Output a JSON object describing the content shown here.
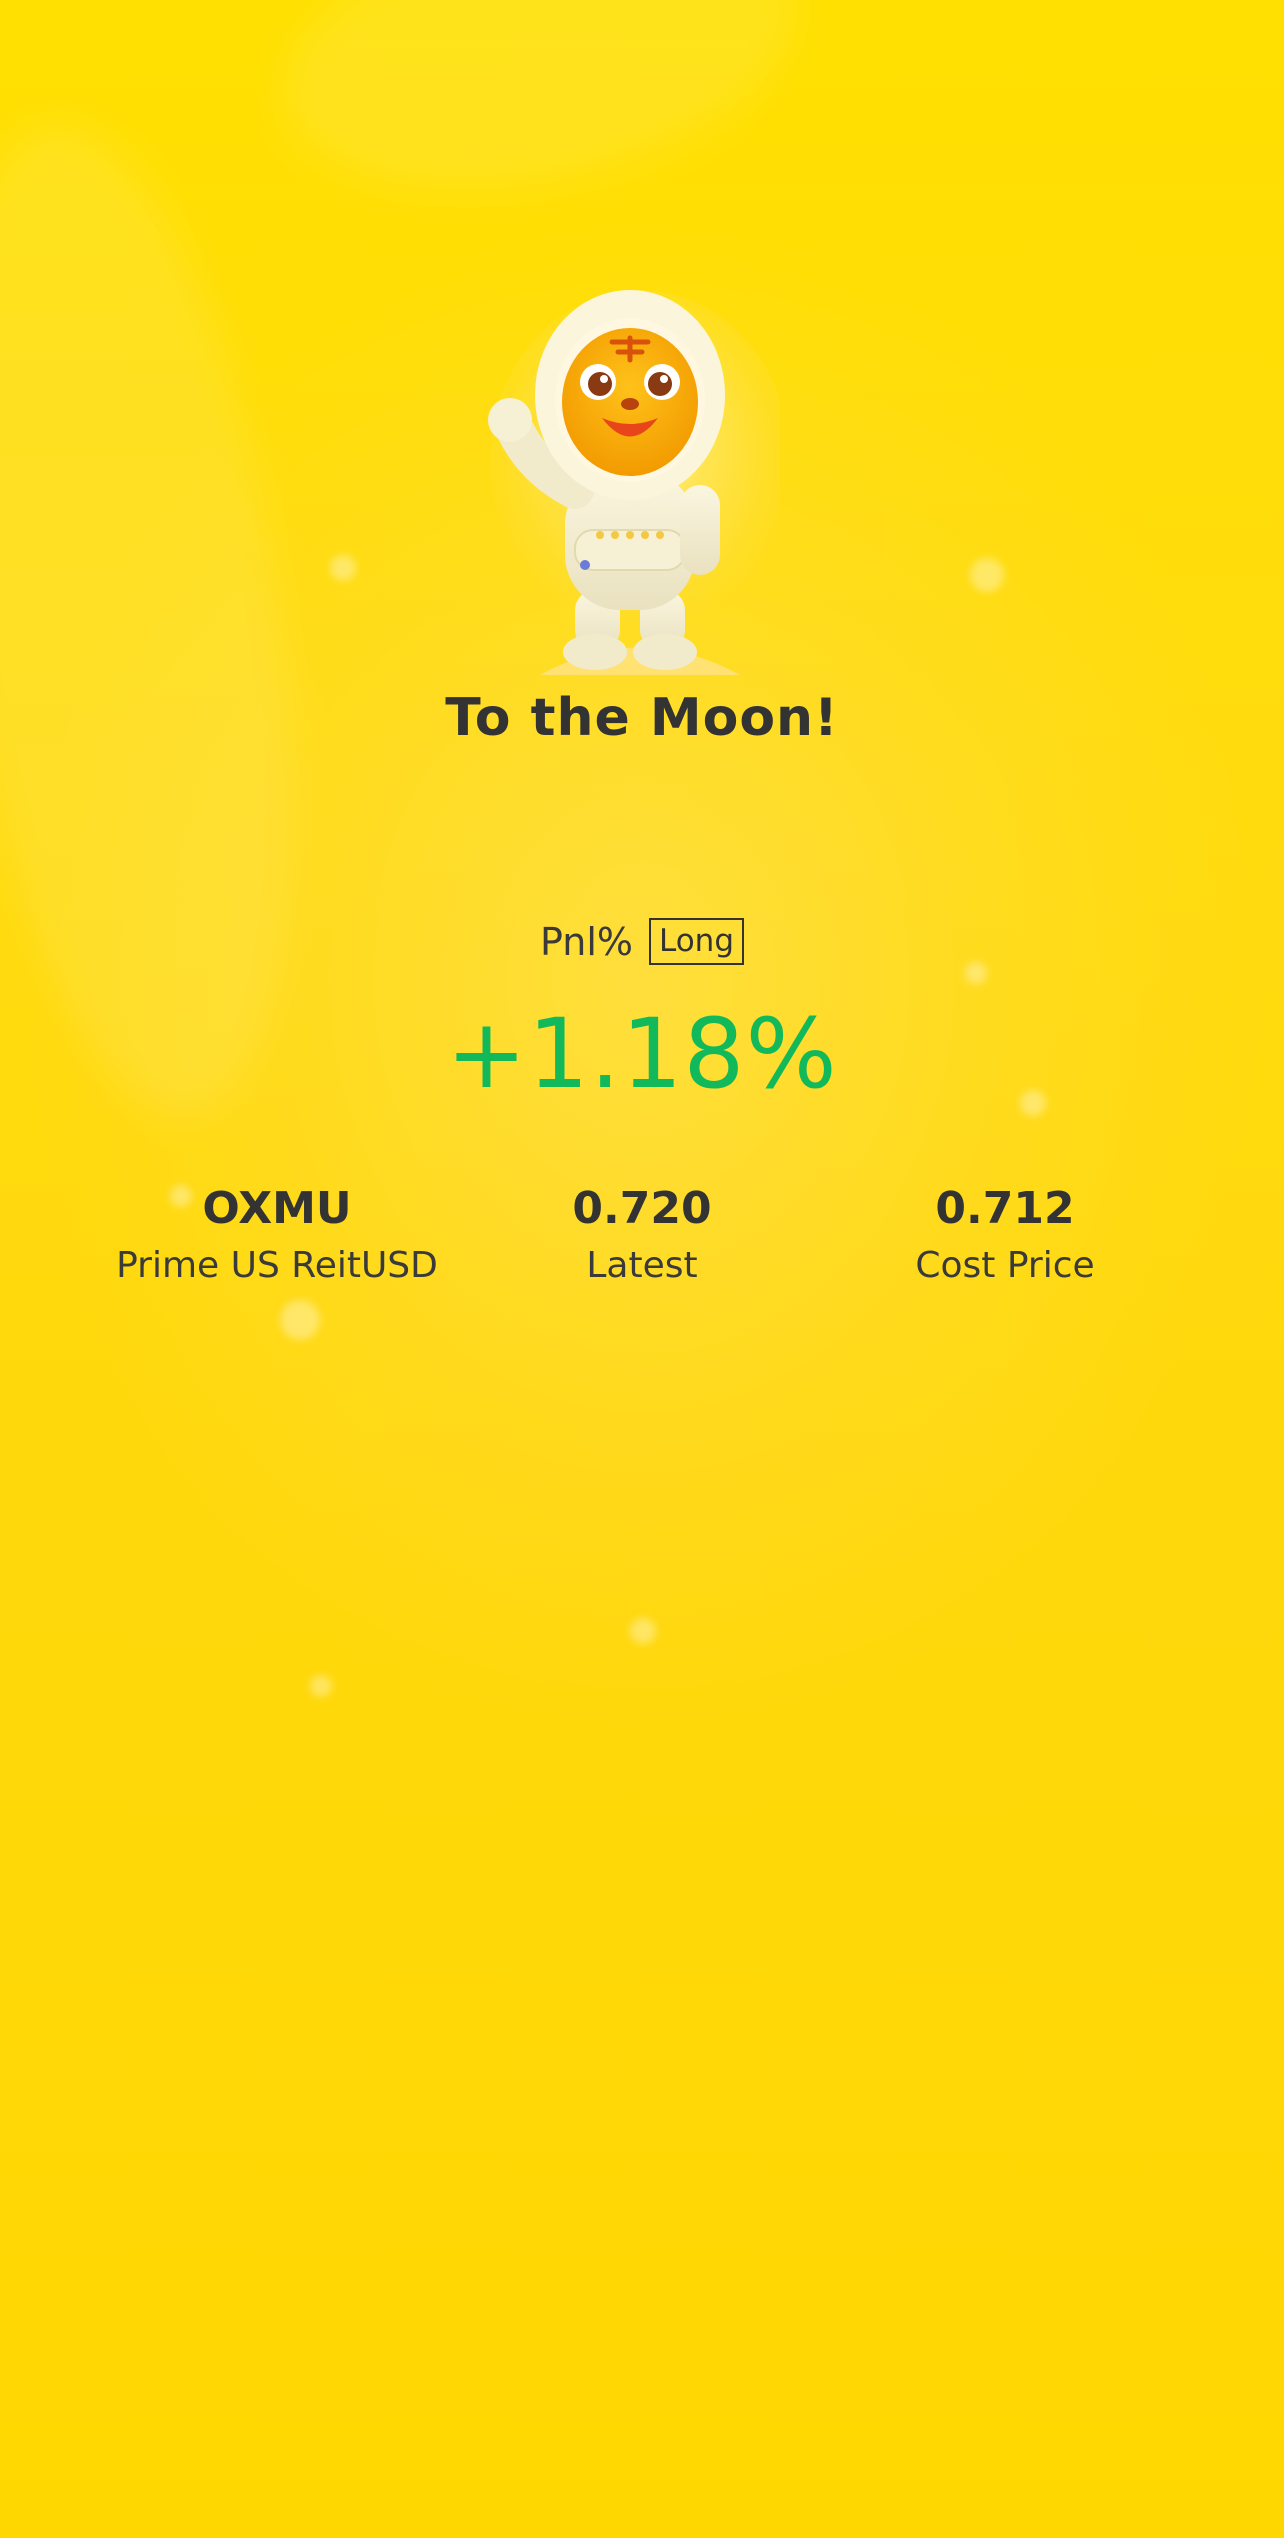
{
  "banner": {
    "title": "To the Moon!"
  },
  "pnl": {
    "label": "Pnl%",
    "direction_badge": "Long",
    "value": "+1.18%",
    "value_color": "#12B95A"
  },
  "stats": [
    {
      "value": "OXMU",
      "label": "Prime US ReitUSD"
    },
    {
      "value": "0.720",
      "label": "Latest"
    },
    {
      "value": "0.712",
      "label": "Cost Price"
    }
  ],
  "theme": {
    "background": "#FFDC00",
    "text": "#333333"
  },
  "illustration": {
    "name": "astronaut-tiger-mascot"
  }
}
